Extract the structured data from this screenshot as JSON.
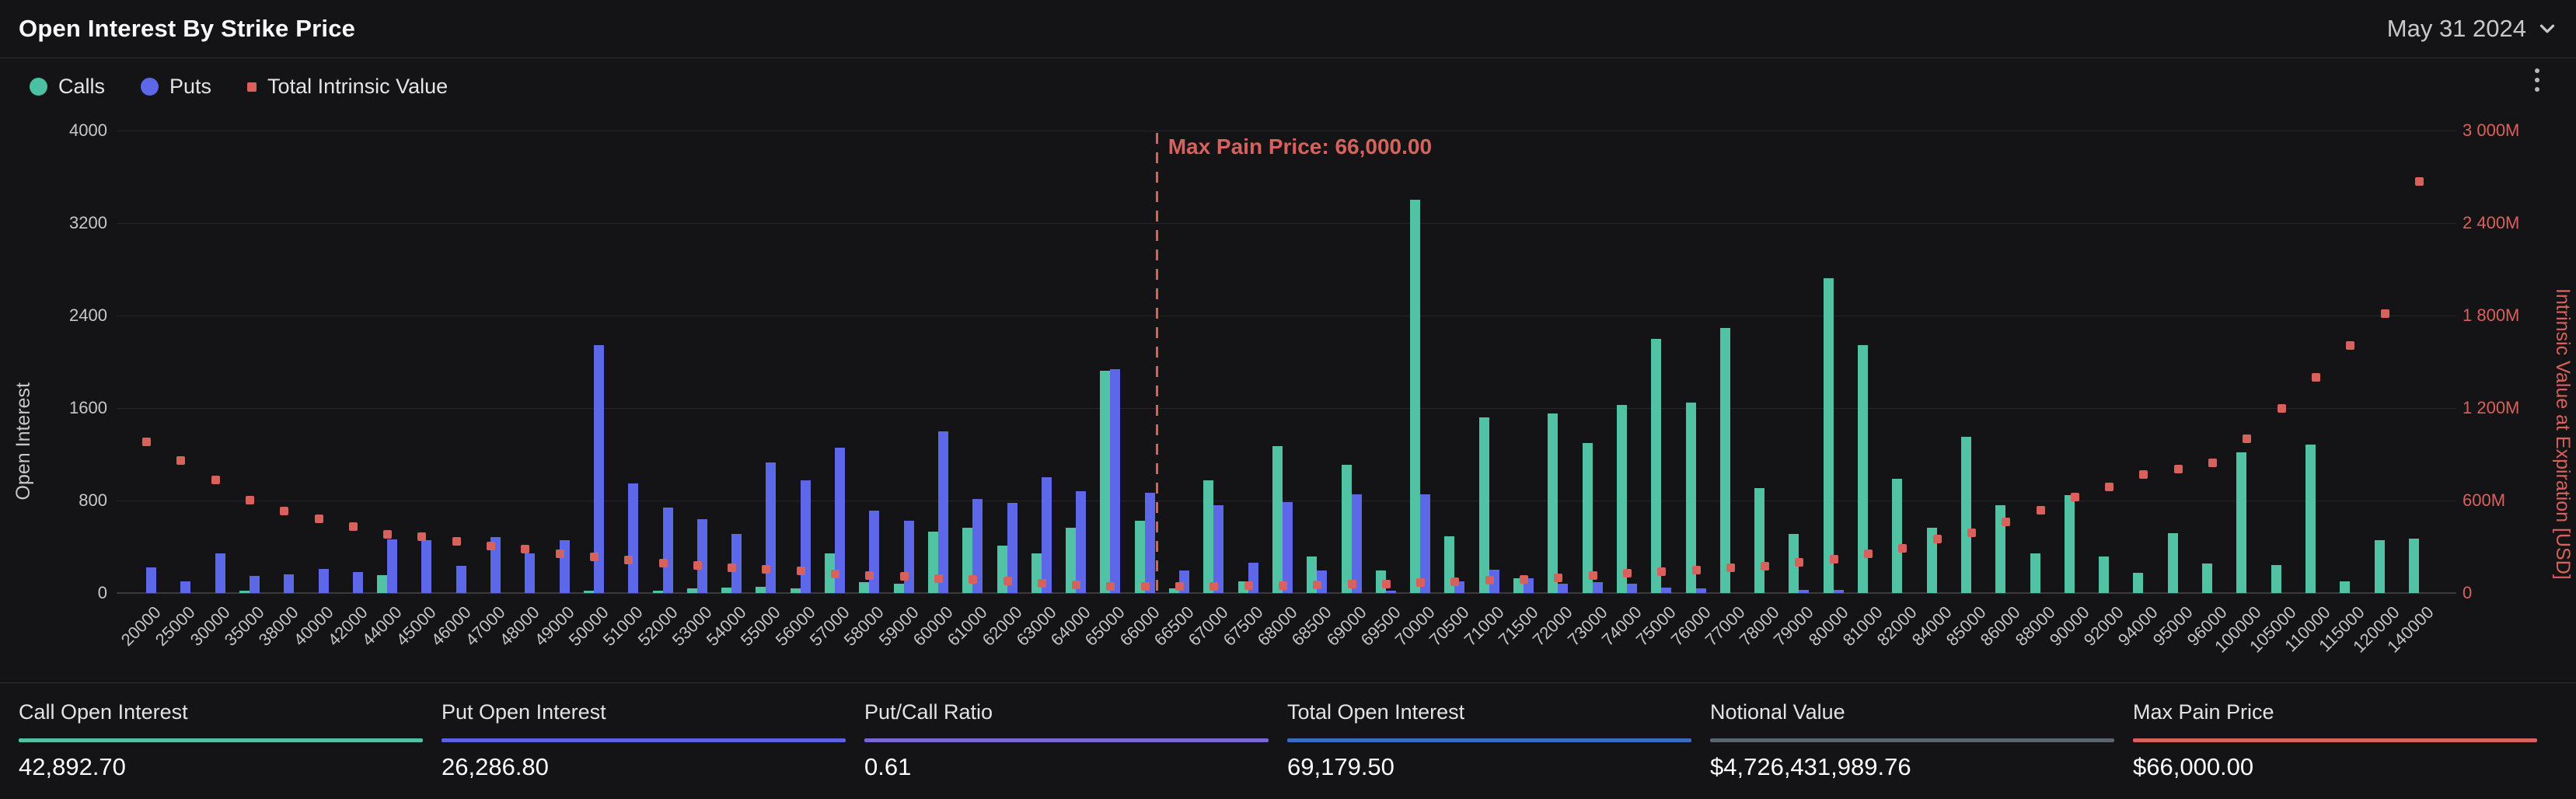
{
  "header": {
    "title": "Open Interest By Strike Price",
    "date": "May 31 2024"
  },
  "legend": {
    "calls": "Calls",
    "puts": "Puts",
    "iv": "Total Intrinsic Value"
  },
  "chart_data": {
    "type": "bar",
    "title": "Open Interest By Strike Price",
    "grid": true,
    "legend_position": "top-left",
    "y_left": {
      "label": "Open Interest",
      "ticks": [
        0,
        800,
        1600,
        2400,
        3200,
        4000
      ],
      "max": 4000
    },
    "y_right": {
      "label": "Intrinsic Value at Expiration [USD]",
      "tick_labels": [
        "0",
        "600M",
        "1 200M",
        "1 800M",
        "2 400M",
        "3 000M"
      ],
      "max_musd": 3000
    },
    "max_pain": {
      "strike": "66000",
      "label": "Max Pain Price: 66,000.00"
    },
    "categories": [
      "20000",
      "25000",
      "30000",
      "35000",
      "38000",
      "40000",
      "42000",
      "44000",
      "45000",
      "46000",
      "47000",
      "48000",
      "49000",
      "50000",
      "51000",
      "52000",
      "53000",
      "54000",
      "55000",
      "56000",
      "57000",
      "58000",
      "59000",
      "60000",
      "61000",
      "62000",
      "63000",
      "64000",
      "65000",
      "66000",
      "66500",
      "67000",
      "67500",
      "68000",
      "68500",
      "69000",
      "69500",
      "70000",
      "70500",
      "71000",
      "71500",
      "72000",
      "73000",
      "74000",
      "75000",
      "76000",
      "77000",
      "78000",
      "79000",
      "80000",
      "81000",
      "82000",
      "84000",
      "85000",
      "86000",
      "88000",
      "90000",
      "92000",
      "94000",
      "95000",
      "96000",
      "100000",
      "105000",
      "110000",
      "115000",
      "120000",
      "140000"
    ],
    "series": [
      {
        "name": "Calls",
        "color": "#52c2a5",
        "values": [
          0,
          0,
          0,
          22,
          0,
          0,
          0,
          157,
          0,
          0,
          0,
          0,
          0,
          20,
          0,
          20,
          38,
          50,
          57,
          43,
          340,
          97,
          84,
          530,
          562,
          408,
          340,
          562,
          1920,
          624,
          43,
          976,
          103,
          1273,
          313,
          1111,
          192,
          3400,
          489,
          1516,
          130,
          1551,
          1300,
          1624,
          2200,
          1650,
          2290,
          908,
          508,
          2720,
          2146,
          989,
          562,
          1354,
          759,
          345,
          850,
          315,
          175,
          515,
          255,
          1220,
          245,
          1285,
          100,
          455,
          470
        ]
      },
      {
        "name": "Puts",
        "color": "#5d68e8",
        "values": [
          224,
          103,
          340,
          151,
          160,
          211,
          181,
          462,
          459,
          232,
          484,
          346,
          459,
          2146,
          946,
          738,
          638,
          508,
          1132,
          976,
          1259,
          713,
          624,
          1395,
          813,
          781,
          1003,
          881,
          1935,
          867,
          192,
          759,
          265,
          786,
          192,
          854,
          22,
          854,
          103,
          200,
          125,
          84,
          97,
          84,
          49,
          43,
          0,
          0,
          30,
          30,
          0,
          0,
          0,
          0,
          0,
          0,
          0,
          0,
          0,
          0,
          0,
          0,
          0,
          0,
          0,
          0,
          0
        ]
      },
      {
        "name": "Total Intrinsic Value",
        "color": "#d9615c",
        "unit": "millions USD",
        "marker": "square",
        "values": [
          985,
          863,
          736,
          604,
          535,
          482,
          432,
          383,
          367,
          336,
          308,
          286,
          259,
          239,
          215,
          195,
          182,
          168,
          154,
          144,
          124,
          118,
          110,
          97,
          89,
          79,
          67,
          55,
          47,
          44,
          45,
          46,
          48,
          50,
          55,
          59,
          63,
          70,
          76,
          85,
          92,
          100,
          115,
          132,
          142,
          152,
          165,
          178,
          200,
          222,
          258,
          290,
          355,
          392,
          465,
          540,
          625,
          690,
          770,
          805,
          845,
          1005,
          1200,
          1400,
          1610,
          1815,
          2670
        ]
      }
    ]
  },
  "stats": {
    "items": [
      {
        "label": "Call Open Interest",
        "value": "42,892.70",
        "color": "#52c2a5"
      },
      {
        "label": "Put Open Interest",
        "value": "26,286.80",
        "color": "#5a62e6"
      },
      {
        "label": "Put/Call Ratio",
        "value": "0.61",
        "color": "#7a68d4"
      },
      {
        "label": "Total Open Interest",
        "value": "69,179.50",
        "color": "#3c6cbe"
      },
      {
        "label": "Notional Value",
        "value": "$4,726,431,989.76",
        "color": "#5a656e"
      },
      {
        "label": "Max Pain Price",
        "value": "$66,000.00",
        "color": "#d9615c"
      }
    ]
  }
}
